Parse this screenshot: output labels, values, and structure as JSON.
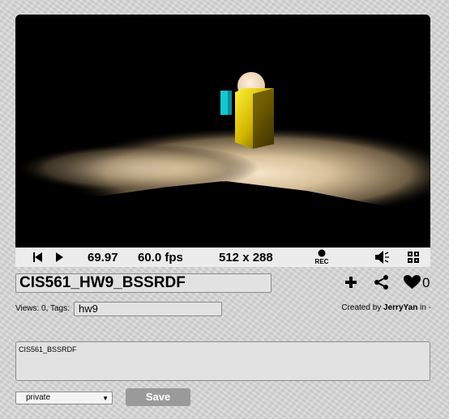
{
  "player": {
    "time": "69.97",
    "fps": "60.0 fps",
    "resolution": "512 x 288",
    "rec_label": "REC"
  },
  "shader": {
    "title": "CIS561_HW9_BSSRDF",
    "views_label": "Views: 0, Tags:",
    "tags": "hw9",
    "created_prefix": "Created by",
    "author": "JerryYan",
    "created_suffix": "in -",
    "likes": "0",
    "description": "CIS561_BSSRDF",
    "privacy": "private",
    "save_label": "Save"
  },
  "icons": [
    "skip-back-icon",
    "play-icon",
    "rec-icon",
    "volume-icon",
    "fullscreen-icon",
    "plus-icon",
    "share-icon",
    "heart-icon",
    "chevron-down-icon"
  ]
}
